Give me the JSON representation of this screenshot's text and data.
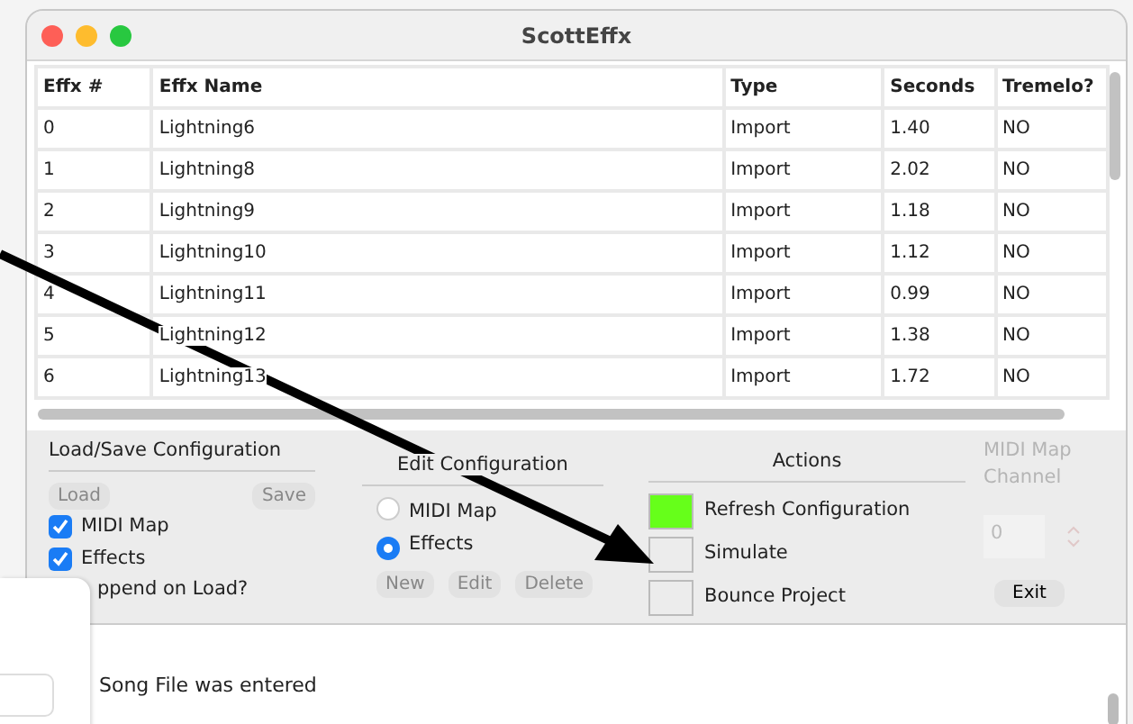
{
  "window": {
    "title": "ScottEffx"
  },
  "table": {
    "columns": [
      "Effx #",
      "Effx Name",
      "Type",
      "Seconds",
      "Tremelo?"
    ],
    "rows": [
      [
        "0",
        "Lightning6",
        "Import",
        "1.40",
        "NO"
      ],
      [
        "1",
        "Lightning8",
        "Import",
        "2.02",
        "NO"
      ],
      [
        "2",
        "Lightning9",
        "Import",
        "1.18",
        "NO"
      ],
      [
        "3",
        "Lightning10",
        "Import",
        "1.12",
        "NO"
      ],
      [
        "4",
        "Lightning11",
        "Import",
        "0.99",
        "NO"
      ],
      [
        "5",
        "Lightning12",
        "Import",
        "1.38",
        "NO"
      ],
      [
        "6",
        "Lightning13",
        "Import",
        "1.72",
        "NO"
      ]
    ]
  },
  "load_save": {
    "title": "Load/Save Configuration",
    "buttons": [
      {
        "label": "Load",
        "disabled": true
      },
      {
        "label": "Save",
        "disabled": true
      }
    ],
    "checkboxes": [
      {
        "label": "MIDI Map",
        "checked": true
      },
      {
        "label": "Effects",
        "checked": true
      },
      {
        "label": "ppend on Load?"
      }
    ]
  },
  "edit": {
    "title": "Edit Configuration",
    "radios": [
      {
        "label": "MIDI Map",
        "selected": false
      },
      {
        "label": "Effects",
        "selected": true
      }
    ],
    "buttons": [
      {
        "label": "New",
        "disabled": true
      },
      {
        "label": "Edit",
        "disabled": true
      },
      {
        "label": "Delete",
        "disabled": true
      }
    ]
  },
  "actions": {
    "title": "Actions",
    "items": [
      {
        "label": "Refresh Configuration",
        "color": "#66ff1a"
      },
      {
        "label": "Simulate",
        "color": "#ececec"
      },
      {
        "label": "Bounce Project",
        "color": "#ececec"
      }
    ]
  },
  "channel": {
    "label": "MIDI Map Channel",
    "value": "0",
    "disabled": true,
    "exit": {
      "label": "Exit",
      "disabled": false
    }
  },
  "log": {
    "lines": [
      "Song File was entered"
    ]
  }
}
